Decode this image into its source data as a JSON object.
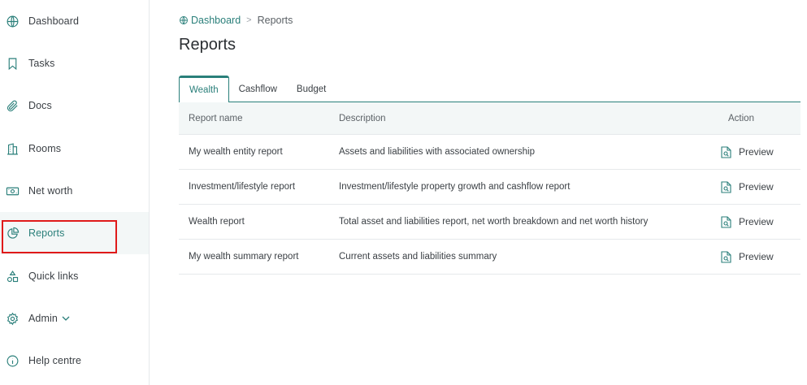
{
  "sidebar": {
    "items": [
      {
        "label": "Dashboard",
        "icon": "globe-icon"
      },
      {
        "label": "Tasks",
        "icon": "bookmark-icon"
      },
      {
        "label": "Docs",
        "icon": "paperclip-icon"
      },
      {
        "label": "Rooms",
        "icon": "building-icon"
      },
      {
        "label": "Net worth",
        "icon": "banknote-icon"
      },
      {
        "label": "Reports",
        "icon": "pie-chart-icon"
      },
      {
        "label": "Quick links",
        "icon": "shapes-icon"
      },
      {
        "label": "Admin",
        "icon": "gear-icon"
      },
      {
        "label": "Help centre",
        "icon": "info-icon"
      }
    ],
    "active": "Reports"
  },
  "breadcrumb": {
    "root": "Dashboard",
    "separator": ">",
    "current": "Reports"
  },
  "page": {
    "title": "Reports"
  },
  "tabs": [
    {
      "label": "Wealth",
      "active": true
    },
    {
      "label": "Cashflow",
      "active": false
    },
    {
      "label": "Budget",
      "active": false
    }
  ],
  "table": {
    "headers": {
      "name": "Report name",
      "description": "Description",
      "action": "Action"
    },
    "rows": [
      {
        "name": "My wealth entity report",
        "description": "Assets and liabilities with associated ownership",
        "action": "Preview"
      },
      {
        "name": "Investment/lifestyle report",
        "description": "Investment/lifestyle property growth and cashflow report",
        "action": "Preview"
      },
      {
        "name": "Wealth report",
        "description": "Total asset and liabilities report, net worth breakdown and net worth history",
        "action": "Preview"
      },
      {
        "name": "My wealth summary report",
        "description": "Current assets and liabilities summary",
        "action": "Preview"
      }
    ]
  },
  "colors": {
    "accent": "#2a7f7a",
    "highlight": "#e01a1a",
    "header_bg": "#f3f7f7"
  }
}
